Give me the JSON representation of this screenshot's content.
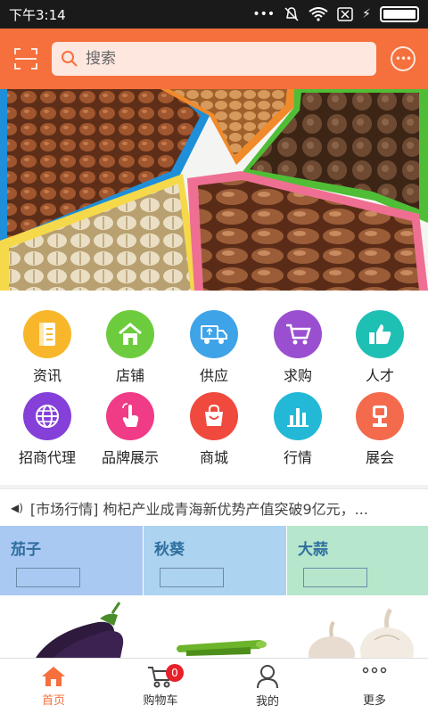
{
  "status_bar": {
    "time": "下午3:14",
    "battery_level": 1.0
  },
  "header": {
    "search_placeholder": "搜索",
    "scan_icon": "scan-icon",
    "chat_icon": "chat-icon",
    "accent_color": "#f5703c"
  },
  "banner": {
    "description_icon": "nuts-tray-image"
  },
  "grid": {
    "items": [
      {
        "label": "资讯",
        "color": "#f8b72b",
        "icon": "document-icon"
      },
      {
        "label": "店铺",
        "color": "#6dcc3d",
        "icon": "house-icon"
      },
      {
        "label": "供应",
        "color": "#3fa3e8",
        "icon": "truck-icon"
      },
      {
        "label": "求购",
        "color": "#9a4fd0",
        "icon": "cart-icon"
      },
      {
        "label": "人才",
        "color": "#1ec0b4",
        "icon": "thumbs-up-icon"
      },
      {
        "label": "招商代理",
        "color": "#8440d8",
        "icon": "globe-icon"
      },
      {
        "label": "品牌展示",
        "color": "#f03b86",
        "icon": "tap-icon"
      },
      {
        "label": "商城",
        "color": "#f04a3e",
        "icon": "bag-icon"
      },
      {
        "label": "行情",
        "color": "#23b9d6",
        "icon": "bar-chart-icon"
      },
      {
        "label": "展会",
        "color": "#f46a4c",
        "icon": "booth-icon"
      }
    ]
  },
  "news": {
    "text": "[市场行情] 枸杞产业成青海新优势产值突破9亿元，..."
  },
  "cards": [
    {
      "title": "茄子",
      "bg": "#aac9f2"
    },
    {
      "title": "秋葵",
      "bg": "#acd3f0"
    },
    {
      "title": "大蒜",
      "bg": "#b6e7cc"
    }
  ],
  "bottom_nav": {
    "items": [
      {
        "label": "首页",
        "icon": "home-icon"
      },
      {
        "label": "购物车",
        "icon": "cart-icon",
        "badge": "0"
      },
      {
        "label": "我的",
        "icon": "user-icon"
      },
      {
        "label": "更多",
        "icon": "more-icon"
      }
    ]
  }
}
